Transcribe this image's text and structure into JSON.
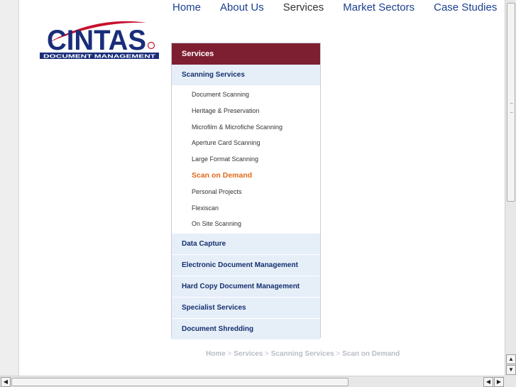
{
  "nav": {
    "items": [
      {
        "label": "Home"
      },
      {
        "label": "About Us"
      },
      {
        "label": "Services"
      },
      {
        "label": "Market Sectors"
      },
      {
        "label": "Case Studies"
      }
    ]
  },
  "logo": {
    "brand": "CINTAS",
    "tagline": "DOCUMENT MANAGEMENT"
  },
  "menu": {
    "header": "Services",
    "sections": [
      {
        "label": "Scanning Services"
      },
      {
        "label": "Data Capture"
      },
      {
        "label": "Electronic Document Management"
      },
      {
        "label": "Hard Copy Document Management"
      },
      {
        "label": "Specialist Services"
      },
      {
        "label": "Document Shredding"
      }
    ],
    "sub_items": [
      {
        "label": "Document Scanning"
      },
      {
        "label": "Heritage & Preservation"
      },
      {
        "label": "Microfilm & Microfiche Scanning"
      },
      {
        "label": "Aperture Card Scanning"
      },
      {
        "label": "Large Format Scanning"
      },
      {
        "label": "Scan on Demand"
      },
      {
        "label": "Personal Projects"
      },
      {
        "label": "Flexiscan"
      },
      {
        "label": "On Site Scanning"
      }
    ]
  },
  "breadcrumb": {
    "items": [
      "Home",
      "Services",
      "Scanning Services",
      "Scan on Demand"
    ],
    "separator": ">"
  },
  "colors": {
    "nav_link": "#1c3f8f",
    "menu_header_bg": "#7d1f31",
    "section_bg": "#e6eef8",
    "active_item": "#e06a1b",
    "logo_blue": "#1a2d7a",
    "logo_red": "#c8102e"
  }
}
